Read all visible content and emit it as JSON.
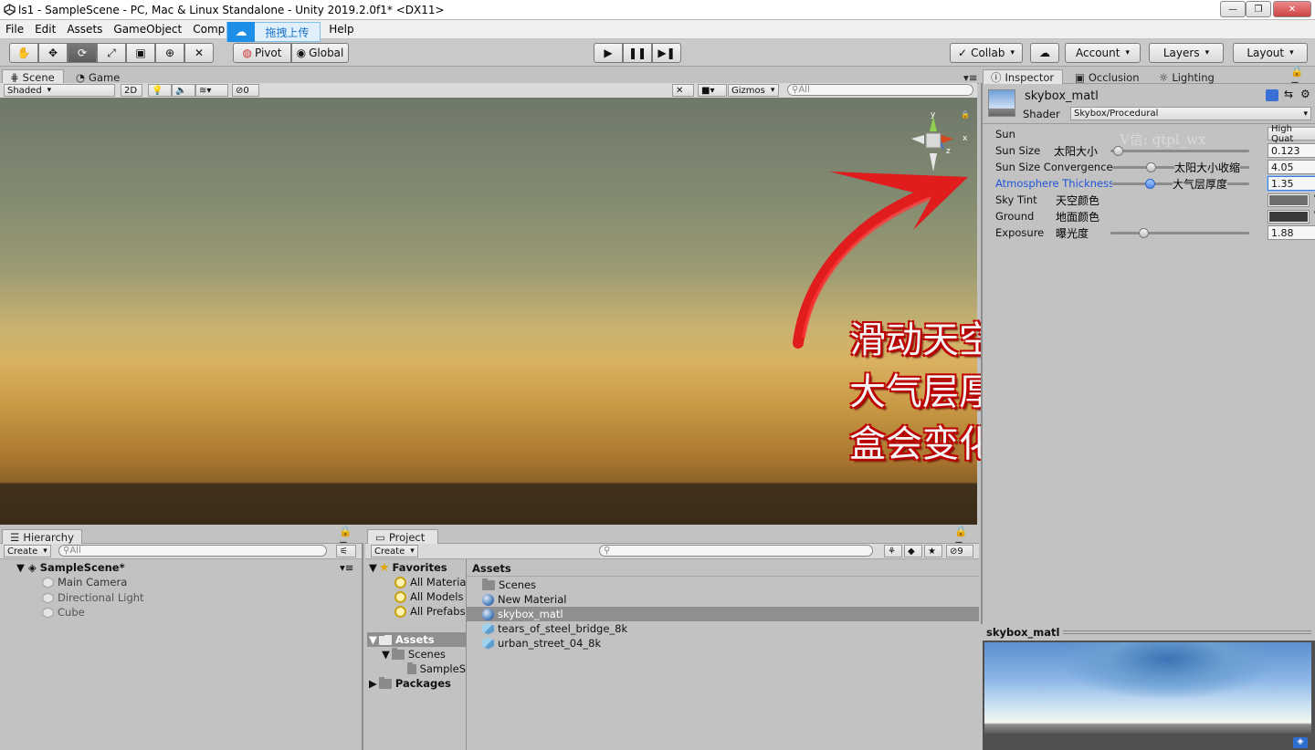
{
  "window": {
    "title": "ls1 - SampleScene - PC, Mac & Linux Standalone - Unity 2019.2.0f1* <DX11>",
    "controls": [
      "—",
      "❐",
      "✕"
    ]
  },
  "menu": [
    "File",
    "Edit",
    "Assets",
    "GameObject",
    "Comp",
    "Help"
  ],
  "upload_popup": {
    "label": "拖拽上传"
  },
  "toolbar": {
    "pivot": "Pivot",
    "global": "Global",
    "collab": "Collab",
    "account": "Account",
    "layers": "Layers",
    "layout": "Layout"
  },
  "scene_panel": {
    "tabs": [
      "Scene",
      "Game"
    ],
    "draw_mode": "Shaded",
    "mode_2d": "2D",
    "hidden_count": "0",
    "gizmos": "Gizmos",
    "search_placeholder": "All",
    "axis_labels": {
      "x": "x",
      "y": "y",
      "z": "z"
    }
  },
  "annotation": {
    "line1": "滑动天空盒材质的",
    "line2": "大气层厚度，天空",
    "line3": "盒会变化"
  },
  "inspector": {
    "tabs": [
      "Inspector",
      "Occlusion",
      "Lighting"
    ],
    "material_name": "skybox_matl",
    "shader_label": "Shader",
    "shader_value": "Skybox/Procedural",
    "watermark": "V信: qtpl_wx",
    "properties": [
      {
        "label": "Sun",
        "note": "",
        "value": "High Quat"
      },
      {
        "label": "Sun Size",
        "note": "太阳大小",
        "value": "0.123",
        "level": 0.05
      },
      {
        "label": "Sun Size Convergence",
        "note": "太阳大小收缩",
        "value": "4.05",
        "level": 0.28
      },
      {
        "label": "Atmosphere Thickness",
        "note": "大气层厚度",
        "value": "1.35",
        "level": 0.27
      },
      {
        "label": "Sky Tint",
        "note": "天空颜色",
        "color": "#6f6f6f"
      },
      {
        "label": "Ground",
        "note": "地面颜色",
        "color": "#3b3b3b"
      },
      {
        "label": "Exposure",
        "note": "曝光度",
        "value": "1.88",
        "level": 0.24
      }
    ],
    "preview_title": "skybox_matl"
  },
  "hierarchy": {
    "tab": "Hierarchy",
    "create": "Create",
    "search_placeholder": "All",
    "scene": "SampleScene*",
    "items": [
      "Main Camera",
      "Directional Light",
      "Cube"
    ]
  },
  "project": {
    "tab": "Project",
    "create": "Create",
    "hidden_count": "9",
    "favorites": "Favorites",
    "fav_items": [
      "All Materia",
      "All Models",
      "All Prefabs"
    ],
    "assets_root": "Assets",
    "scenes_folder": "Scenes",
    "scene_file": "SampleS",
    "packages": "Packages",
    "assets_header": "Assets",
    "files": [
      "Scenes",
      "New Material",
      "skybox_matl",
      "tears_of_steel_bridge_8k",
      "urban_street_04_8k"
    ]
  },
  "colors": {
    "editor_bg": "#c2c2c2",
    "selection_blue": "#3d7bdc",
    "annotation_red": "#c00000",
    "highlight_label": "#1f55d8"
  }
}
